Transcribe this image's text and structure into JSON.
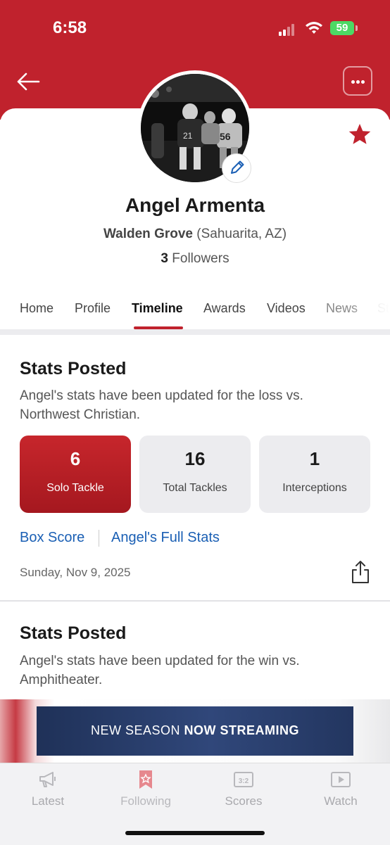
{
  "status_bar": {
    "time": "6:58",
    "battery": "59"
  },
  "header": {
    "back_icon": "arrow-left-icon",
    "more_icon": "ellipsis-icon"
  },
  "profile": {
    "name": "Angel Armenta",
    "school": "Walden Grove",
    "location": "(Sahuarita, AZ)",
    "followers_count": "3",
    "followers_label": "Followers",
    "favorite_icon": "star-icon",
    "edit_icon": "pencil-icon"
  },
  "tabs": [
    {
      "label": "Home"
    },
    {
      "label": "Profile"
    },
    {
      "label": "Timeline",
      "active": true
    },
    {
      "label": "Awards"
    },
    {
      "label": "Videos"
    },
    {
      "label": "News"
    },
    {
      "label": "St"
    }
  ],
  "cards": [
    {
      "title": "Stats Posted",
      "description": "Angel's stats have been updated for the loss vs. Northwest Christian.",
      "stats": [
        {
          "value": "6",
          "label": "Solo Tackle",
          "selected": true
        },
        {
          "value": "16",
          "label": "Total Tackles"
        },
        {
          "value": "1",
          "label": "Interceptions"
        }
      ],
      "links": [
        "Box Score",
        "Angel's Full Stats"
      ],
      "date": "Sunday, Nov 9, 2025",
      "share_icon": "share-icon"
    },
    {
      "title": "Stats Posted",
      "description": "Angel's stats have been updated for the win vs. Amphitheater."
    }
  ],
  "ad": {
    "text_normal": "NEW SEASON",
    "text_bold": "NOW STREAMING"
  },
  "bottom_nav": [
    {
      "label": "Latest",
      "icon": "megaphone-icon"
    },
    {
      "label": "Following",
      "icon": "bookmark-star-icon"
    },
    {
      "label": "Scores",
      "icon": "scoreboard-icon"
    },
    {
      "label": "Watch",
      "icon": "play-icon"
    }
  ],
  "colors": {
    "brand_red": "#c0222d",
    "link_blue": "#1a5fb4",
    "battery_green": "#4cd964"
  }
}
